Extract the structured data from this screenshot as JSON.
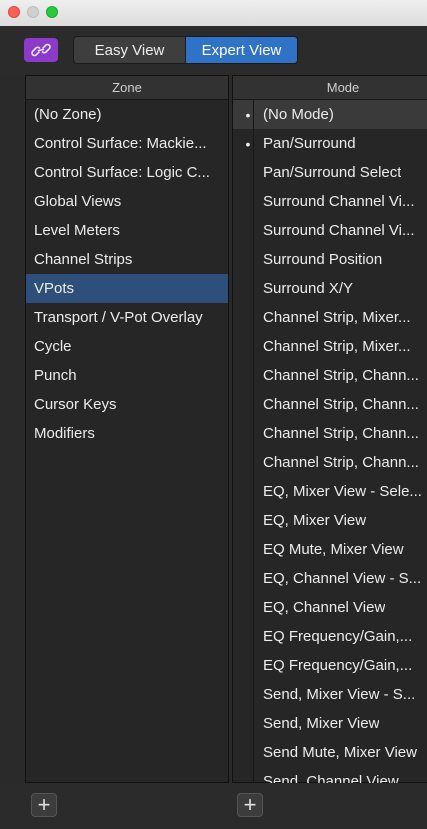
{
  "toolbar": {
    "link_icon": "link-icon",
    "view_tabs": [
      {
        "label": "Easy View",
        "active": false
      },
      {
        "label": "Expert View",
        "active": true
      }
    ],
    "accent_purple": "#8b3ac9",
    "accent_blue": "#2f73c9"
  },
  "zone": {
    "header": "Zone",
    "items": [
      {
        "label": "(No Zone)"
      },
      {
        "label": "Control Surface: Mackie..."
      },
      {
        "label": "Control Surface: Logic C..."
      },
      {
        "label": "Global Views"
      },
      {
        "label": "Level Meters"
      },
      {
        "label": "Channel Strips"
      },
      {
        "label": "VPots",
        "selected": true
      },
      {
        "label": "Transport / V-Pot Overlay"
      },
      {
        "label": "Cycle"
      },
      {
        "label": "Punch"
      },
      {
        "label": "Cursor Keys"
      },
      {
        "label": "Modifiers"
      }
    ],
    "add_label": "+"
  },
  "mode": {
    "header": "Mode",
    "items": [
      {
        "label": "(No Mode)",
        "bullet": "•"
      },
      {
        "label": "Pan/Surround",
        "bullet": "•"
      },
      {
        "label": "Pan/Surround Select",
        "bullet": ""
      },
      {
        "label": "Surround Channel Vi...",
        "bullet": ""
      },
      {
        "label": "Surround Channel Vi...",
        "bullet": ""
      },
      {
        "label": "Surround Position",
        "bullet": ""
      },
      {
        "label": "Surround X/Y",
        "bullet": ""
      },
      {
        "label": "Channel Strip, Mixer...",
        "bullet": ""
      },
      {
        "label": "Channel Strip, Mixer...",
        "bullet": ""
      },
      {
        "label": "Channel Strip, Chann...",
        "bullet": ""
      },
      {
        "label": "Channel Strip, Chann...",
        "bullet": ""
      },
      {
        "label": "Channel Strip, Chann...",
        "bullet": ""
      },
      {
        "label": "Channel Strip, Chann...",
        "bullet": ""
      },
      {
        "label": "EQ, Mixer View - Sele...",
        "bullet": ""
      },
      {
        "label": "EQ, Mixer View",
        "bullet": ""
      },
      {
        "label": "EQ Mute, Mixer View",
        "bullet": ""
      },
      {
        "label": "EQ, Channel View - S...",
        "bullet": ""
      },
      {
        "label": "EQ, Channel View",
        "bullet": ""
      },
      {
        "label": "EQ Frequency/Gain,...",
        "bullet": ""
      },
      {
        "label": "EQ Frequency/Gain,...",
        "bullet": ""
      },
      {
        "label": "Send, Mixer View - S...",
        "bullet": ""
      },
      {
        "label": "Send, Mixer View",
        "bullet": ""
      },
      {
        "label": "Send Mute, Mixer View",
        "bullet": ""
      },
      {
        "label": "Send, Channel View",
        "bullet": ""
      }
    ],
    "add_label": "+"
  }
}
